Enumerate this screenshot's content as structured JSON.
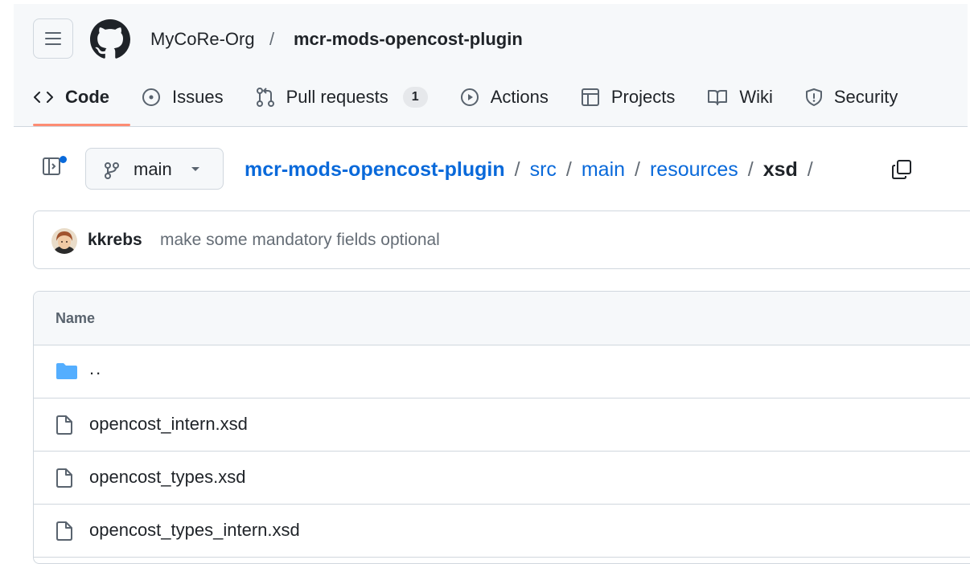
{
  "header": {
    "owner": "MyCoRe-Org",
    "separator": "/",
    "repo": "mcr-mods-opencost-plugin",
    "tabs": [
      {
        "label": "Code",
        "icon": "code-icon",
        "active": true
      },
      {
        "label": "Issues",
        "icon": "issue-opened-icon"
      },
      {
        "label": "Pull requests",
        "icon": "git-pull-request-icon",
        "counter": "1"
      },
      {
        "label": "Actions",
        "icon": "play-icon"
      },
      {
        "label": "Projects",
        "icon": "table-icon"
      },
      {
        "label": "Wiki",
        "icon": "book-icon"
      },
      {
        "label": "Security",
        "icon": "shield-icon"
      }
    ]
  },
  "path_bar": {
    "branch": "main",
    "segments": [
      "mcr-mods-opencost-plugin",
      "src",
      "main",
      "resources"
    ],
    "current": "xsd",
    "separator": "/"
  },
  "commit": {
    "author": "kkrebs",
    "message": "make some mandatory fields optional"
  },
  "files": {
    "header": "Name",
    "parent": "..",
    "items": [
      "opencost_intern.xsd",
      "opencost_types.xsd",
      "opencost_types_intern.xsd"
    ]
  },
  "colors": {
    "accent": "#0969da",
    "tab_underline": "#fd8c73",
    "folder": "#54aeff"
  }
}
